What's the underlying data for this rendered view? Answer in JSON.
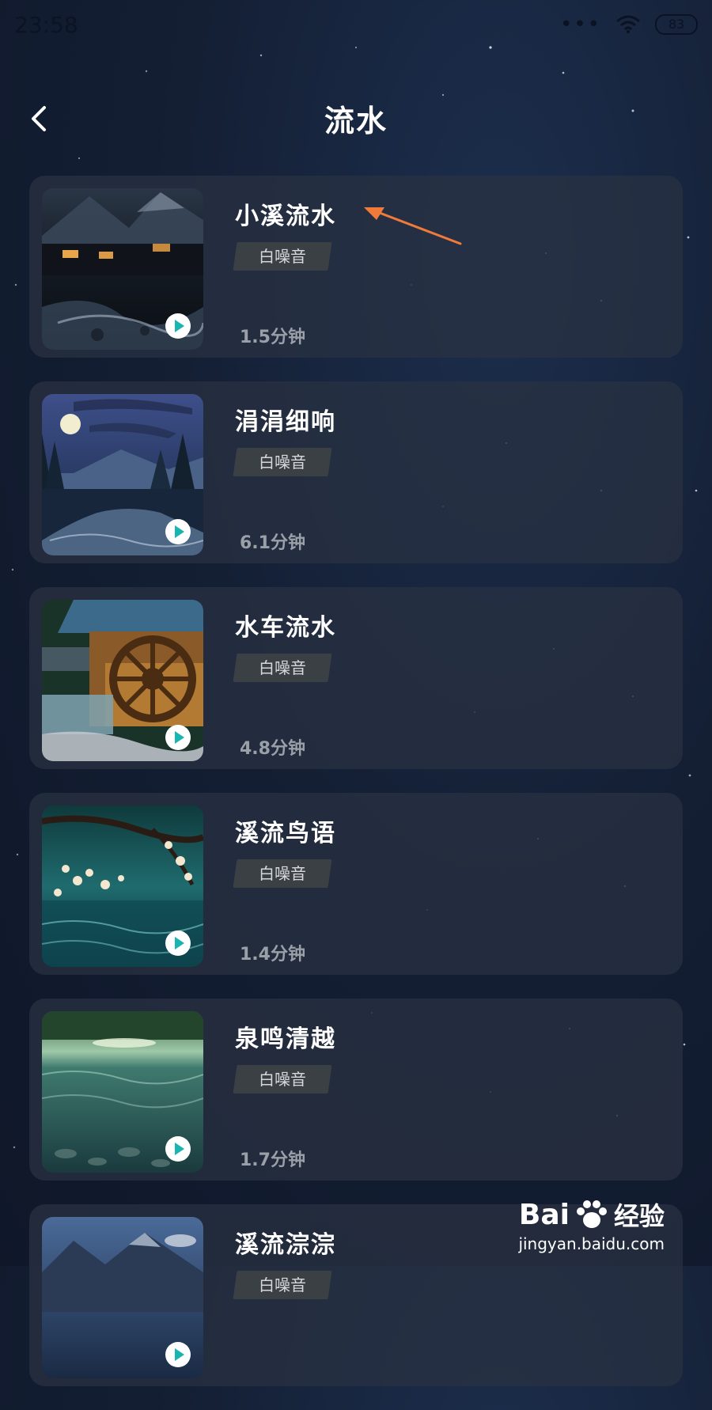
{
  "status_bar": {
    "time": "23:58",
    "signal_dots": "•••",
    "battery": "83"
  },
  "header": {
    "title": "流水"
  },
  "items": [
    {
      "title": "小溪流水",
      "tag": "白噪音",
      "duration": "1.5分钟",
      "thumb": "mountain-village-stream"
    },
    {
      "title": "涓涓细响",
      "tag": "白噪音",
      "duration": "6.1分钟",
      "thumb": "moonlit-forest-river"
    },
    {
      "title": "水车流水",
      "tag": "白噪音",
      "duration": "4.8分钟",
      "thumb": "water-wheel"
    },
    {
      "title": "溪流鸟语",
      "tag": "白噪音",
      "duration": "1.4分钟",
      "thumb": "blossom-pond"
    },
    {
      "title": "泉鸣清越",
      "tag": "白噪音",
      "duration": "1.7分钟",
      "thumb": "forest-lake"
    },
    {
      "title": "溪流淙淙",
      "tag": "白噪音",
      "duration": "",
      "thumb": "mountain-lake"
    }
  ],
  "watermark": {
    "logo_text": "Bai",
    "brand_text": "经验",
    "url": "jingyan.baidu.com"
  },
  "colors": {
    "play_accent": "#19b5b0",
    "annotation_arrow": "#f07a3a"
  }
}
